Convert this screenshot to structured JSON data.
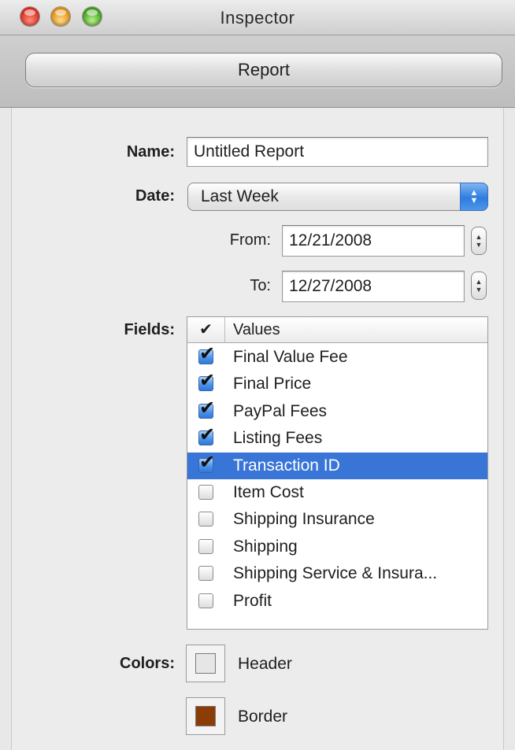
{
  "window": {
    "title": "Inspector"
  },
  "toolbar": {
    "report_label": "Report"
  },
  "form": {
    "name_label": "Name:",
    "name_value": "Untitled Report",
    "date_label": "Date:",
    "date_value": "Last Week",
    "from_label": "From:",
    "from_value": "12/21/2008",
    "to_label": "To:",
    "to_value": "12/27/2008",
    "fields_label": "Fields:",
    "colors_label": "Colors:"
  },
  "fields_table": {
    "check_header": "✔",
    "values_header": "Values",
    "rows": [
      {
        "label": "Final Value Fee",
        "checked": true,
        "selected": false
      },
      {
        "label": "Final Price",
        "checked": true,
        "selected": false
      },
      {
        "label": "PayPal Fees",
        "checked": true,
        "selected": false
      },
      {
        "label": "Listing Fees",
        "checked": true,
        "selected": false
      },
      {
        "label": "Transaction ID",
        "checked": true,
        "selected": true
      },
      {
        "label": "Item Cost",
        "checked": false,
        "selected": false
      },
      {
        "label": "Shipping Insurance",
        "checked": false,
        "selected": false
      },
      {
        "label": "Shipping",
        "checked": false,
        "selected": false
      },
      {
        "label": "Shipping Service & Insura...",
        "checked": false,
        "selected": false
      },
      {
        "label": "Profit",
        "checked": false,
        "selected": false
      }
    ]
  },
  "colors": {
    "header_label": "Header",
    "header_color": "#e6e6e6",
    "border_label": "Border",
    "border_color": "#8a3d06"
  },
  "accent": {
    "selection": "#3875d7"
  }
}
